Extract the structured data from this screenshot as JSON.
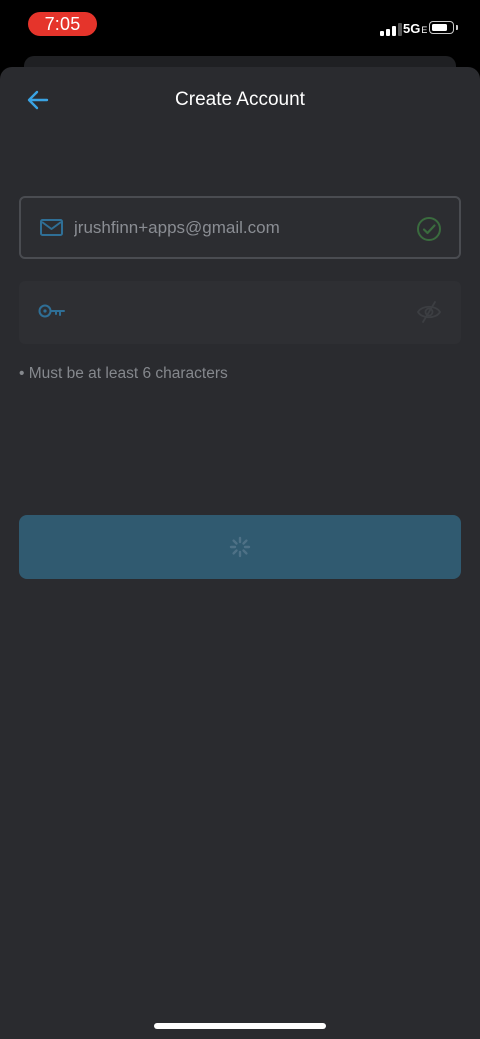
{
  "status_bar": {
    "time": "7:05",
    "network": "5G",
    "network_suffix": "E",
    "signal_bars": 3,
    "signal_bars_total": 4,
    "battery_level": 0.7
  },
  "header": {
    "title": "Create Account",
    "back_icon": "arrow-left-icon"
  },
  "form": {
    "email": {
      "value": "jrushfinn+apps@gmail.com",
      "icon": "mail-icon",
      "status_icon": "check-circle-icon"
    },
    "password": {
      "value": "",
      "placeholder": "",
      "icon": "key-icon",
      "toggle_icon": "eye-off-icon"
    },
    "hint": "• Must be at least 6 characters",
    "submit": {
      "state": "loading",
      "icon": "spinner-icon"
    }
  },
  "colors": {
    "accent": "#3aa3e3",
    "sheet_background": "#2a2b2f",
    "button_background": "#305a70",
    "success": "#4caf50",
    "time_pill": "#e5342b"
  }
}
